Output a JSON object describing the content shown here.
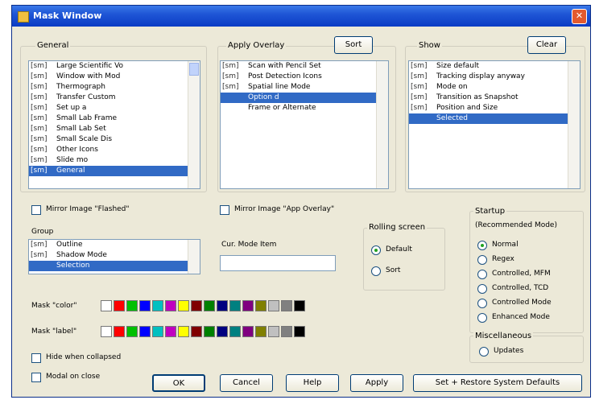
{
  "title": "Mask Window",
  "panels": {
    "general": {
      "title": "General",
      "items": [
        {
          "tag": "[sm]",
          "text": "Large Scientific Vo",
          "selected": false
        },
        {
          "tag": "[sm]",
          "text": "Window with Mod",
          "selected": false
        },
        {
          "tag": "[sm]",
          "text": "Thermograph",
          "selected": false
        },
        {
          "tag": "[sm]",
          "text": "Transfer Custom",
          "selected": false
        },
        {
          "tag": "[sm]",
          "text": "Set up a",
          "selected": false
        },
        {
          "tag": "[sm]",
          "text": "Small Lab Frame",
          "selected": false
        },
        {
          "tag": "[sm]",
          "text": "Small Lab Set",
          "selected": false
        },
        {
          "tag": "[sm]",
          "text": "Small Scale Dis",
          "selected": false
        },
        {
          "tag": "[sm]",
          "text": "Other Icons",
          "selected": false
        },
        {
          "tag": "[sm]",
          "text": "Slide mo",
          "selected": false
        },
        {
          "tag": "[sm]",
          "text": "General",
          "selected": true
        }
      ]
    },
    "apply_overlay": {
      "title": "Apply Overlay",
      "button": "Sort",
      "items": [
        {
          "tag": "[sm]",
          "text": "Scan with Pencil Set",
          "selected": false
        },
        {
          "tag": "[sm]",
          "text": "Post Detection Icons",
          "selected": false
        },
        {
          "tag": "[sm]",
          "text": "Spatial line Mode",
          "selected": false
        },
        {
          "tag": "",
          "text": "Option d",
          "selected": true
        },
        {
          "tag": "",
          "text": "Frame or Alternate",
          "selected": false
        }
      ]
    },
    "show": {
      "title": "Show",
      "button": "Clear",
      "items": [
        {
          "tag": "[sm]",
          "text": "Size default",
          "selected": false
        },
        {
          "tag": "[sm]",
          "text": "Tracking display anyway",
          "selected": false
        },
        {
          "tag": "[sm]",
          "text": "Mode on",
          "selected": false
        },
        {
          "tag": "[sm]",
          "text": "Transition as Snapshot",
          "selected": false
        },
        {
          "tag": "[sm]",
          "text": "Position and Size",
          "selected": false
        },
        {
          "tag": "",
          "text": "Selected",
          "selected": true
        }
      ]
    },
    "group_list": {
      "title": "Group",
      "items": [
        {
          "tag": "[sm]",
          "text": "Outline",
          "selected": false
        },
        {
          "tag": "[sm]",
          "text": "Shadow Mode",
          "selected": false
        },
        {
          "tag": "",
          "text": "Selection",
          "selected": true
        }
      ]
    }
  },
  "checks": {
    "mirror_general": "Mirror Image \"Flashed\"",
    "mirror_apply": "Mirror Image \"App Overlay\"",
    "hide_when_collapsed": "Hide when collapsed",
    "modal_on_close": "Modal on close"
  },
  "filename": {
    "label": "Cur. Mode Item",
    "value": ""
  },
  "rolling": {
    "title": "Rolling screen",
    "options": [
      {
        "label": "Default",
        "selected": true
      },
      {
        "label": "Sort",
        "selected": false
      }
    ]
  },
  "startup": {
    "title": "Startup",
    "subtitle": "(Recommended Mode)",
    "options": [
      {
        "label": "Normal",
        "selected": true
      },
      {
        "label": "Regex",
        "selected": false
      },
      {
        "label": "Controlled, MFM",
        "selected": false
      },
      {
        "label": "Controlled, TCD",
        "selected": false
      },
      {
        "label": "Controlled Mode",
        "selected": false
      },
      {
        "label": "Enhanced Mode",
        "selected": false
      }
    ],
    "multiline_title": "Miscellaneous",
    "multiline_option": "Updates"
  },
  "palettes": {
    "label1": "Mask \"color\"",
    "label2": "Mask \"label\"",
    "colors": [
      "#ffffff",
      "#ff0000",
      "#00c000",
      "#0000ff",
      "#00c0c0",
      "#c000c0",
      "#ffff00",
      "#800000",
      "#008000",
      "#000080",
      "#008080",
      "#800080",
      "#808000",
      "#c0c0c0",
      "#808080",
      "#000000"
    ]
  },
  "buttons": {
    "ok": "OK",
    "cancel": "Cancel",
    "help": "Help",
    "apply": "Apply",
    "defaults": "Set + Restore System Defaults"
  },
  "colors": {
    "titlebar": "#1f56d6",
    "selection": "#316ac5",
    "face": "#ece9d8"
  }
}
